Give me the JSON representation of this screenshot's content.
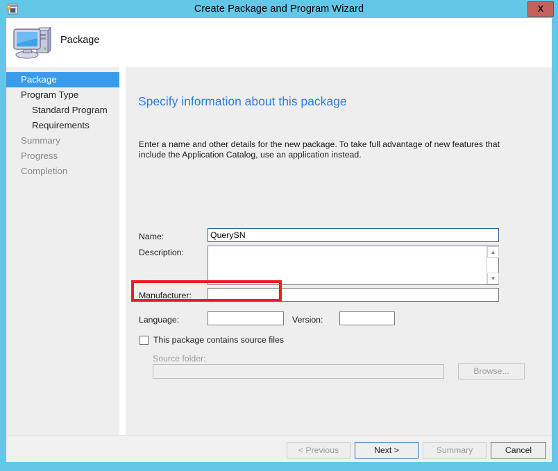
{
  "window": {
    "title": "Create Package and Program Wizard",
    "title_icon": "package-wizard-icon",
    "close_label": "X",
    "frame_color": "#63c8e8"
  },
  "header": {
    "icon": "computer-icon",
    "title": "Package"
  },
  "sidebar": {
    "items": [
      {
        "label": "Package",
        "state": "selected",
        "indent": false
      },
      {
        "label": "Program Type",
        "state": "normal",
        "indent": false
      },
      {
        "label": "Standard Program",
        "state": "normal",
        "indent": true
      },
      {
        "label": "Requirements",
        "state": "normal",
        "indent": true
      },
      {
        "label": "Summary",
        "state": "dim",
        "indent": false
      },
      {
        "label": "Progress",
        "state": "dim",
        "indent": false
      },
      {
        "label": "Completion",
        "state": "dim",
        "indent": false
      }
    ],
    "selected_color": "#3a9bea"
  },
  "content": {
    "heading": "Specify information about this package",
    "heading_color": "#2a7de1",
    "description": "Enter a name and other details for the new package. To take full advantage of new features that include the Application Catalog, use an application instead.",
    "fields": {
      "name_label": "Name:",
      "name_value": "QuerySN",
      "name_placeholder": "",
      "description_label": "Description:",
      "description_value": "",
      "description_placeholder": "",
      "manufacturer_label": "Manufacturer:",
      "manufacturer_value": "",
      "manufacturer_placeholder": "",
      "language_label": "Language:",
      "language_value": "",
      "language_placeholder": "",
      "version_label": "Version:",
      "version_value": "",
      "version_placeholder": ""
    },
    "checkbox": {
      "label": "This package contains source files",
      "checked": false
    },
    "source_folder": {
      "label": "Source folder:",
      "value": "",
      "placeholder": "",
      "browse_label": "Browse...",
      "enabled": false
    },
    "annotation_color": "#ed1b24",
    "scrollbar": {
      "up_icon": "chevron-up-icon",
      "down_icon": "chevron-down-icon"
    }
  },
  "footer": {
    "previous_label": "< Previous",
    "next_label": "Next >",
    "summary_label": "Summary",
    "cancel_label": "Cancel"
  }
}
